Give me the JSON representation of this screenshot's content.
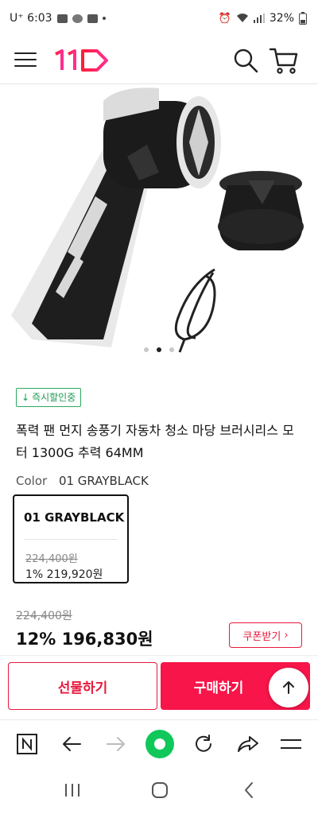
{
  "status_bar": {
    "carrier_time": "U⁺ 6:03",
    "battery": "32%"
  },
  "header": {
    "logo_text": "11"
  },
  "gallery": {
    "image_count": 3,
    "active_index": 1
  },
  "product": {
    "badge": "즉시할인중",
    "title": "폭력 팬 먼지 송풍기 자동차 청소 마당 브러시리스 모터 1300G 추력 64MM",
    "option_label": "Color",
    "option_value": "01 GRAYBLACK",
    "option_card": {
      "name": "01 GRAYBLACK",
      "original_price": "224,400원",
      "sale_price": "1% 219,920원"
    },
    "original_price": "224,400원",
    "sale_price": "12% 196,830원",
    "coupon_label": "쿠폰받기"
  },
  "actions": {
    "gift_label": "선물하기",
    "buy_label": "구매하기"
  },
  "colors": {
    "accent": "#f7154a",
    "badge_green": "#1d9a52"
  }
}
